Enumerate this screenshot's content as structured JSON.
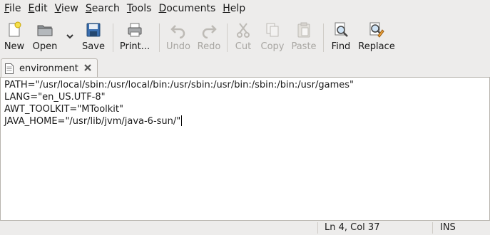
{
  "menubar": {
    "items": [
      {
        "label": "File",
        "accel": "F",
        "rest": "ile"
      },
      {
        "label": "Edit",
        "accel": "E",
        "rest": "dit"
      },
      {
        "label": "View",
        "accel": "V",
        "rest": "iew"
      },
      {
        "label": "Search",
        "accel": "S",
        "rest": "earch"
      },
      {
        "label": "Tools",
        "accel": "T",
        "rest": "ools"
      },
      {
        "label": "Documents",
        "accel": "D",
        "rest": "ocuments"
      },
      {
        "label": "Help",
        "accel": "H",
        "rest": "elp"
      }
    ]
  },
  "toolbar": {
    "new_label": "New",
    "open_label": "Open",
    "save_label": "Save",
    "print_label": "Print...",
    "undo_label": "Undo",
    "redo_label": "Redo",
    "cut_label": "Cut",
    "copy_label": "Copy",
    "paste_label": "Paste",
    "find_label": "Find",
    "replace_label": "Replace"
  },
  "tab": {
    "label": "environment"
  },
  "editor": {
    "lines": [
      "PATH=\"/usr/local/sbin:/usr/local/bin:/usr/sbin:/usr/bin:/sbin:/bin:/usr/games\"",
      "LANG=\"en_US.UTF-8\"",
      "AWT_TOOLKIT=\"MToolkit\"",
      "JAVA_HOME=\"/usr/lib/jvm/java-6-sun/\""
    ]
  },
  "statusbar": {
    "position": "Ln 4, Col 37",
    "mode": "INS"
  },
  "icons": {
    "new": "new-document-icon",
    "open": "folder-open-icon",
    "save": "floppy-disk-icon",
    "print": "printer-icon",
    "undo": "undo-arrow-icon",
    "redo": "redo-arrow-icon",
    "cut": "scissors-icon",
    "copy": "copy-icon",
    "paste": "clipboard-icon",
    "find": "magnifier-icon",
    "replace": "find-replace-icon"
  }
}
